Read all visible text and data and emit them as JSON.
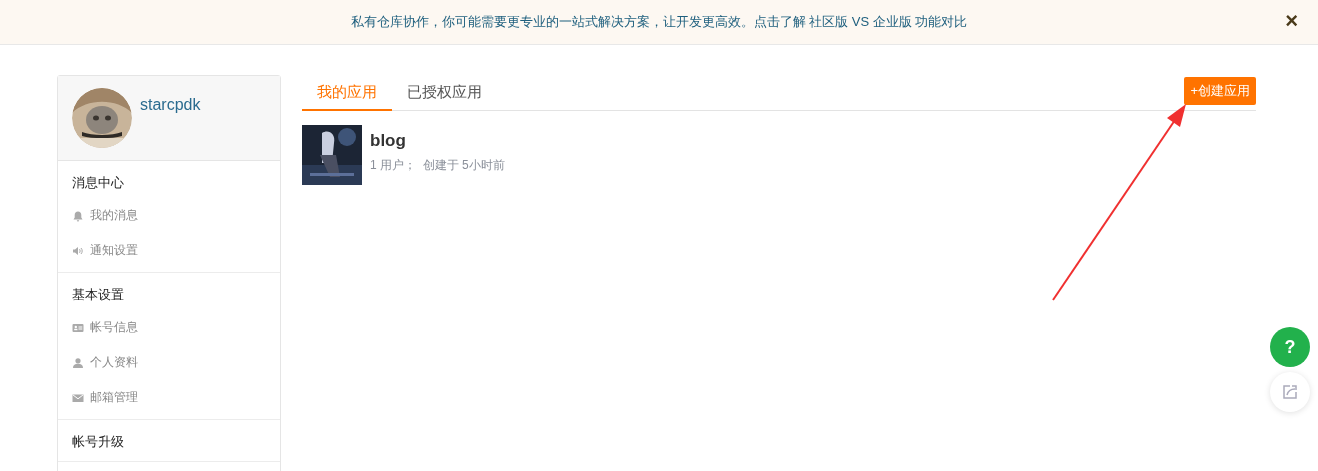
{
  "banner": {
    "text": "私有仓库协作，你可能需要更专业的一站式解决方案，让开发更高效。点击了解 社区版 VS 企业版 功能对比",
    "close": "×"
  },
  "profile": {
    "username": "starcpdk"
  },
  "sidebar": {
    "sections": [
      {
        "title": "消息中心",
        "items": [
          "我的消息",
          "通知设置"
        ]
      },
      {
        "title": "基本设置",
        "items": [
          "帐号信息",
          "个人资料",
          "邮箱管理"
        ]
      },
      {
        "title": "帐号升级"
      }
    ]
  },
  "tabs": [
    {
      "label": "我的应用",
      "selected": true
    },
    {
      "label": "已授权应用",
      "selected": false
    }
  ],
  "create_button": "+创建应用",
  "apps": [
    {
      "name": "blog",
      "meta": "1 用户；  创建于 5小时前"
    }
  ],
  "float_buttons": {
    "help": "?"
  }
}
